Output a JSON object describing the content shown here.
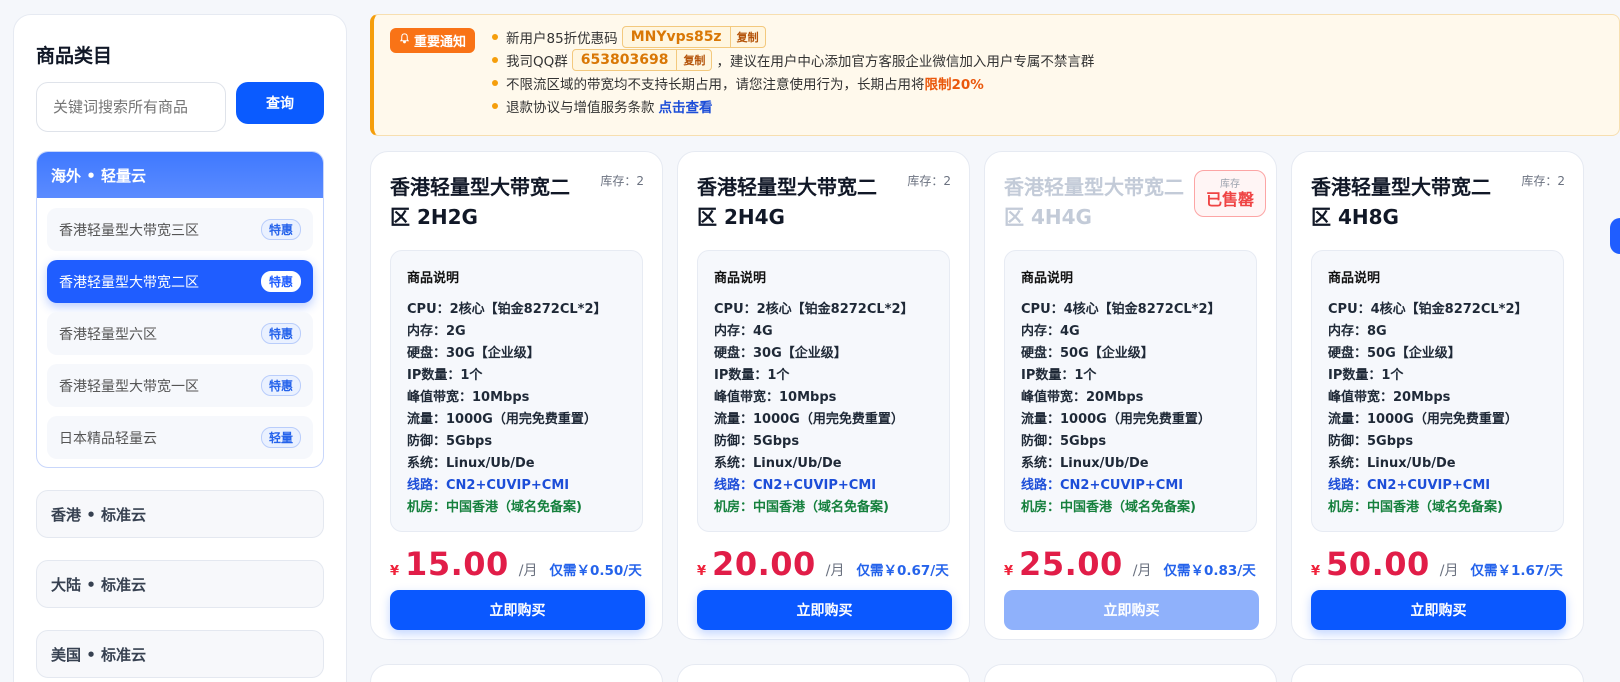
{
  "sidebar": {
    "title": "商品类目",
    "search_placeholder": "关键词搜索所有商品",
    "search_button": "查询",
    "open_group": {
      "label": "海外 • 轻量云",
      "items": [
        {
          "label": "香港轻量型大带宽三区",
          "badge": "特惠"
        },
        {
          "label": "香港轻量型大带宽二区",
          "badge": "特惠"
        },
        {
          "label": "香港轻量型六区",
          "badge": "特惠"
        },
        {
          "label": "香港轻量型大带宽一区",
          "badge": "特惠"
        },
        {
          "label": "日本精品轻量云",
          "badge": "轻量"
        }
      ]
    },
    "groups": [
      "香港 • 标准云",
      "大陆 • 标准云",
      "美国 • 标准云"
    ]
  },
  "notice": {
    "tag": "重要通知",
    "line1_prefix": "新用户85折优惠码",
    "promo_code": "MNYvps85z",
    "copy": "复制",
    "line2_prefix": "我司QQ群",
    "qq_group": "653803698",
    "line2_suffix": "，建议在用户中心添加官方客服企业微信加入用户专属不禁言群",
    "line3_prefix": "不限流区域的带宽均不支持长期占用，请您注意使用行为，长期占用将",
    "line3_highlight": "限制20%",
    "line4_prefix": "退款协议与增值服务条款",
    "line4_link": "点击查看"
  },
  "common": {
    "spec_title": "商品说明",
    "yen": "¥",
    "unit": "/月",
    "buy": "立即购买",
    "sold_small": "库存",
    "sold_big": "已售罄"
  },
  "products": [
    {
      "title": "香港轻量型大带宽二区 2H2G",
      "stock": "库存：2",
      "specs": [
        "CPU：2核心【铂金8272CL*2】",
        "内存：2G",
        "硬盘：30G【企业级】",
        "IP数量：1个",
        "峰值带宽：10Mbps",
        "流量：1000G（用完免费重置）",
        "防御：5Gbps",
        "系统：Linux/Ub/De"
      ],
      "line": "线路：CN2+CUVIP+CMI",
      "room": "机房：中国香港（域名免备案)",
      "price": "15.00",
      "daily": "仅需￥0.50/天"
    },
    {
      "title": "香港轻量型大带宽二区 2H4G",
      "stock": "库存：2",
      "specs": [
        "CPU：2核心【铂金8272CL*2】",
        "内存：4G",
        "硬盘：30G【企业级】",
        "IP数量：1个",
        "峰值带宽：10Mbps",
        "流量：1000G（用完免费重置）",
        "防御：5Gbps",
        "系统：Linux/Ub/De"
      ],
      "line": "线路：CN2+CUVIP+CMI",
      "room": "机房：中国香港（域名免备案)",
      "price": "20.00",
      "daily": "仅需￥0.67/天"
    },
    {
      "title": "香港轻量型大带宽二区 4H4G",
      "stock": "",
      "specs": [
        "CPU：4核心【铂金8272CL*2】",
        "内存：4G",
        "硬盘：50G【企业级】",
        "IP数量：1个",
        "峰值带宽：20Mbps",
        "流量：1000G（用完免费重置）",
        "防御：5Gbps",
        "系统：Linux/Ub/De"
      ],
      "line": "线路：CN2+CUVIP+CMI",
      "room": "机房：中国香港（域名免备案)",
      "price": "25.00",
      "daily": "仅需￥0.83/天"
    },
    {
      "title": "香港轻量型大带宽二区 4H8G",
      "stock": "库存：2",
      "specs": [
        "CPU：4核心【铂金8272CL*2】",
        "内存：8G",
        "硬盘：50G【企业级】",
        "IP数量：1个",
        "峰值带宽：20Mbps",
        "流量：1000G（用完免费重置）",
        "防御：5Gbps",
        "系统：Linux/Ub/De"
      ],
      "line": "线路：CN2+CUVIP+CMI",
      "room": "机房：中国香港（域名免备案)",
      "price": "50.00",
      "daily": "仅需￥1.67/天"
    }
  ]
}
